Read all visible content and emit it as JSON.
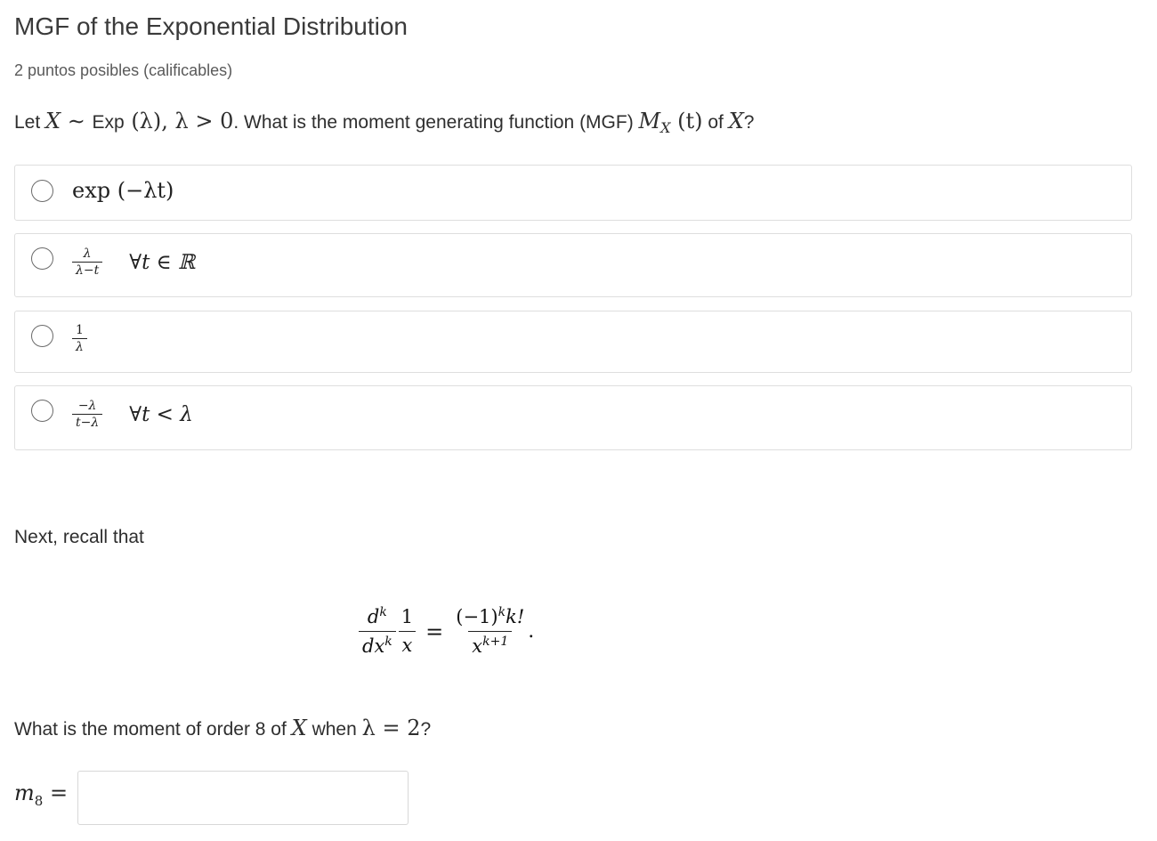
{
  "problem": {
    "title": "MGF of the Exponential Distribution",
    "points": "2 puntos posibles (calificables)",
    "question": {
      "let": "Let ",
      "X": "X",
      "sim": " ∼ ",
      "exp_word": "Exp",
      "lambda_arg": " (λ), λ > 0",
      "what": ". What is the moment generating function (MGF) ",
      "mgf": "M",
      "mgf_sub": "X",
      "mgf_arg": " (t)",
      "of": " of ",
      "X2": "X",
      "qmark": "?"
    }
  },
  "choices": [
    {
      "expr": "exp (−λt)"
    },
    {
      "num": "λ",
      "den": "λ−t",
      "cond": "∀t ∈ ℝ"
    },
    {
      "num": "1",
      "den": "λ"
    },
    {
      "num": "−λ",
      "den": "t−λ",
      "cond": "∀t < λ"
    }
  ],
  "recall": "Next, recall that",
  "equation": {
    "d_num": "d",
    "k": "k",
    "d_den": "dx",
    "one": "1",
    "x": "x",
    "equals": "=",
    "rhs_num": "(−1)",
    "rhs_num_tail": "k!",
    "rhs_den": "x",
    "rhs_den_exp": "k+1",
    "period": "."
  },
  "order_question": {
    "prefix": "What is the moment of order 8 of ",
    "X": "X",
    "when": " when ",
    "cond": "λ = 2",
    "qmark": "?"
  },
  "answer": {
    "label": "m",
    "label_sub": "8",
    "equals": " =",
    "value": "",
    "placeholder": ""
  }
}
